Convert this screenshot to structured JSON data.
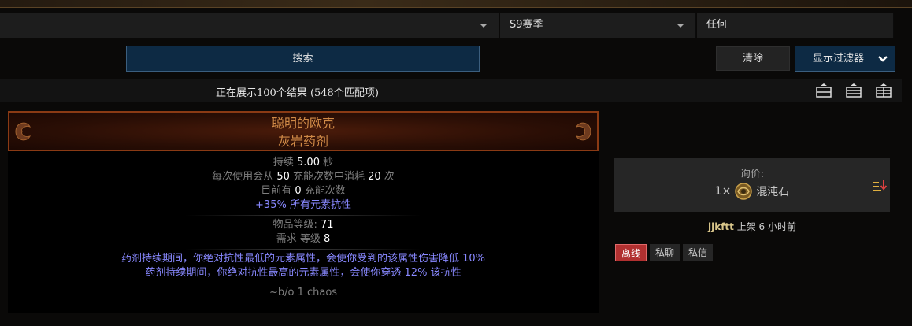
{
  "filters": {
    "select1_value": "",
    "league_value": "S9赛季",
    "status_value": "任何"
  },
  "buttons": {
    "search": "搜索",
    "clear": "清除",
    "show_filters": "显示过滤器"
  },
  "results": {
    "summary": "正在展示100个结果 (548个匹配项)"
  },
  "item": {
    "name_line1": "聪明的欧克",
    "name_line2": "灰岩药剂",
    "duration_label": "持续 ",
    "duration_value": "5.00",
    "duration_unit": " 秒",
    "consume_prefix": "每次使用会从 ",
    "consume_from": "50",
    "consume_mid": " 充能次数中消耗 ",
    "consume_value": "20",
    "consume_suffix": " 次",
    "current_prefix": "目前有 ",
    "current_value": "0",
    "current_suffix": " 充能次数",
    "implicit_mod": "+35% 所有元素抗性",
    "ilvl_label": "物品等级: ",
    "ilvl_value": "71",
    "req_label": "需求 等级 ",
    "req_value": "8",
    "explicit_mod1": "药剂持续期间，你绝对抗性最低的元素属性，会使你受到的该属性伤害降低 10%",
    "explicit_mod2": "药剂持续期间，你绝对抗性最高的元素属性，会使你穿透 12% 该抗性",
    "note": "~b/o 1 chaos"
  },
  "price": {
    "label": "询价:",
    "amount": "1×",
    "currency": "混沌石"
  },
  "seller": {
    "account": "jjkftt",
    "listed": " 上架 6 小时前"
  },
  "seller_buttons": {
    "offline": "离线",
    "whisper": "私聊",
    "message": "私信"
  },
  "colors": {
    "unique_name": "#d08a47",
    "magic_mod": "#8888ff",
    "offline": "#b13030",
    "button_blue": "#0d2a44"
  }
}
